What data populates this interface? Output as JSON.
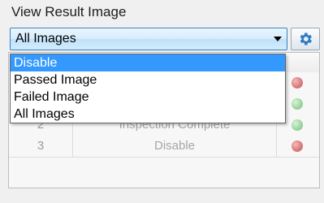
{
  "label": "View Result Image",
  "select": {
    "value": "All Images"
  },
  "settings_button": {
    "icon": "gear-icon",
    "color": "#2e7bc4"
  },
  "dropdown": {
    "options": [
      "Disable",
      "Passed Image",
      "Failed Image",
      "All Images"
    ],
    "highlighted": "Disable"
  },
  "table": {
    "rows": [
      {
        "num": "",
        "status": "",
        "led": "red"
      },
      {
        "num": "",
        "status": "",
        "led": "green"
      },
      {
        "num": "2",
        "status": "Inspection Complete",
        "led": "green"
      },
      {
        "num": "3",
        "status": "Disable",
        "led": "red"
      }
    ]
  }
}
